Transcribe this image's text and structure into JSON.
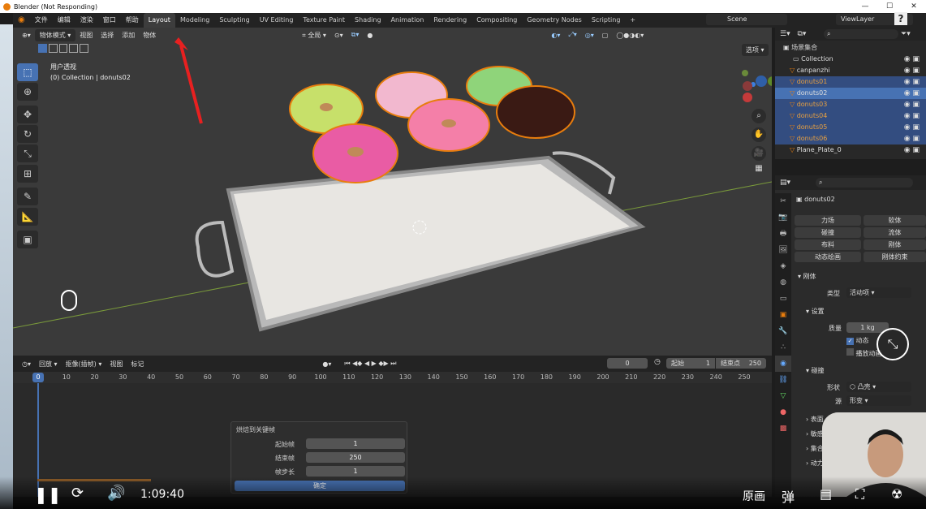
{
  "titlebar": {
    "title": "Blender (Not Responding)",
    "min": "—",
    "max": "☐",
    "close": "✕"
  },
  "menu": [
    "文件",
    "编辑",
    "渲染",
    "窗口",
    "帮助"
  ],
  "workspaces": [
    {
      "label": "Layout",
      "active": true
    },
    {
      "label": "Modeling"
    },
    {
      "label": "Sculpting"
    },
    {
      "label": "UV Editing"
    },
    {
      "label": "Texture Paint"
    },
    {
      "label": "Shading"
    },
    {
      "label": "Animation"
    },
    {
      "label": "Rendering"
    },
    {
      "label": "Compositing"
    },
    {
      "label": "Geometry Nodes"
    },
    {
      "label": "Scripting"
    },
    {
      "label": "+"
    }
  ],
  "scene": {
    "label": "Scene",
    "viewlayer": "ViewLayer"
  },
  "viewport": {
    "mode": "物体模式",
    "menus": [
      "视图",
      "选择",
      "添加",
      "物体"
    ],
    "orientation": "全局",
    "options": "选项",
    "overlay_title": "用户透视",
    "overlay_collection": "(0) Collection | donuts02"
  },
  "timeline": {
    "menus": [
      "回放",
      "抠像(插帧)",
      "视图",
      "标记"
    ],
    "current_frame": "0",
    "start_label": "起始",
    "start": "1",
    "end_label": "结束点",
    "end": "250",
    "ruler": [
      "0",
      "10",
      "20",
      "30",
      "40",
      "50",
      "60",
      "70",
      "80",
      "90",
      "100",
      "110",
      "120",
      "130",
      "140",
      "150",
      "160",
      "170",
      "180",
      "190",
      "200",
      "210",
      "220",
      "230",
      "240",
      "250"
    ]
  },
  "bake_panel": {
    "title": "烘焙到关键帧",
    "rows": [
      {
        "label": "起始帧",
        "value": "1"
      },
      {
        "label": "结束帧",
        "value": "250"
      },
      {
        "label": "帧步长",
        "value": "1"
      }
    ],
    "ok": "确定"
  },
  "outliner": {
    "header": "场景集合",
    "rows": [
      {
        "name": "Collection",
        "sel": false,
        "orange": false
      },
      {
        "name": "canpanzhi",
        "sel": false,
        "orange": false
      },
      {
        "name": "donuts01",
        "sel": true,
        "orange": true
      },
      {
        "name": "donuts02",
        "sel": true,
        "orange": false,
        "active": true
      },
      {
        "name": "donuts03",
        "sel": true,
        "orange": true
      },
      {
        "name": "donuts04",
        "sel": true,
        "orange": true
      },
      {
        "name": "donuts05",
        "sel": true,
        "orange": true
      },
      {
        "name": "donuts06",
        "sel": true,
        "orange": true
      },
      {
        "name": "Plane_Plate_0",
        "sel": false,
        "orange": false
      }
    ]
  },
  "properties": {
    "object": "donuts02",
    "physics_buttons": [
      [
        "力场",
        "软体"
      ],
      [
        "碰撞",
        "流体"
      ],
      [
        "布料",
        "刚体"
      ],
      [
        "动态绘画",
        "刚体约束"
      ]
    ],
    "rigidbody": "刚体",
    "type_label": "类型",
    "type_value": "活动项",
    "settings": "设置",
    "mass_label": "质量",
    "mass_value": "1 kg",
    "dynamic": "动态",
    "animated": "播放动画",
    "collision": "碰撞",
    "shape_label": "形状",
    "shape_value": "凸壳",
    "source_label": "源",
    "source_value": "形变",
    "sub": [
      "表面",
      "敏感",
      "集合",
      "动力学"
    ]
  },
  "player": {
    "time": "1:09:40",
    "quality": "原画"
  },
  "colors": {
    "accent": "#4772b3",
    "orange": "#e87d0d",
    "bg": "#3a3a3a"
  }
}
